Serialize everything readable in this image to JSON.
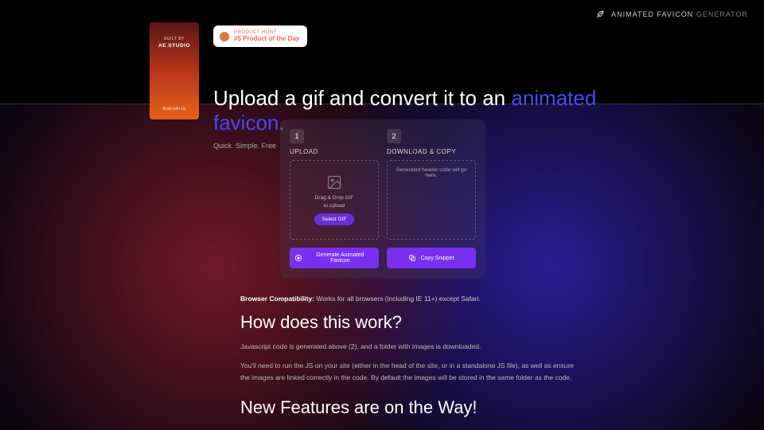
{
  "header": {
    "brand_left": "ANIMATED FAVICON",
    "brand_right": "GENERATOR"
  },
  "sidebar": {
    "built_by": "BUILT BY",
    "brand": "AE.STUDIO",
    "cta": "Build with Us"
  },
  "product_hunt": {
    "label": "PRODUCT HUNT",
    "rank": "#5 Product of the Day"
  },
  "hero": {
    "title_before": "Upload a gif and convert it to an ",
    "title_accent": "animated favicon",
    "title_after": ".",
    "subtitle": "Quick. Simple. Free"
  },
  "uploader": {
    "step1_num": "1",
    "step1_label": "UPLOAD",
    "drop_line1": "Drag & Drop GIF",
    "drop_line2": "to upload",
    "select_btn": "Select GIF",
    "step2_num": "2",
    "step2_label": "DOWNLOAD & COPY",
    "code_placeholder": "Generated header code will go here.",
    "generate_btn": "Generate Animated Favicon",
    "copy_btn": "Copy Snippet"
  },
  "below": {
    "compat_label": "Browser Compatibility:",
    "compat_text": " Works for all browsers (including IE 11+) except Safari.",
    "how_heading": "How does this work?",
    "how_p1": "Javascript code is generated above (2), and a folder with images is downloaded.",
    "how_p2": "You'll need to run the JS on your site (either in the head of the site, or in a standalone JS file), as well as ensure the images are linked correctly in the code. By default the images will be stored in the same folder as the code.",
    "new_heading": "New Features are on the Way!"
  }
}
